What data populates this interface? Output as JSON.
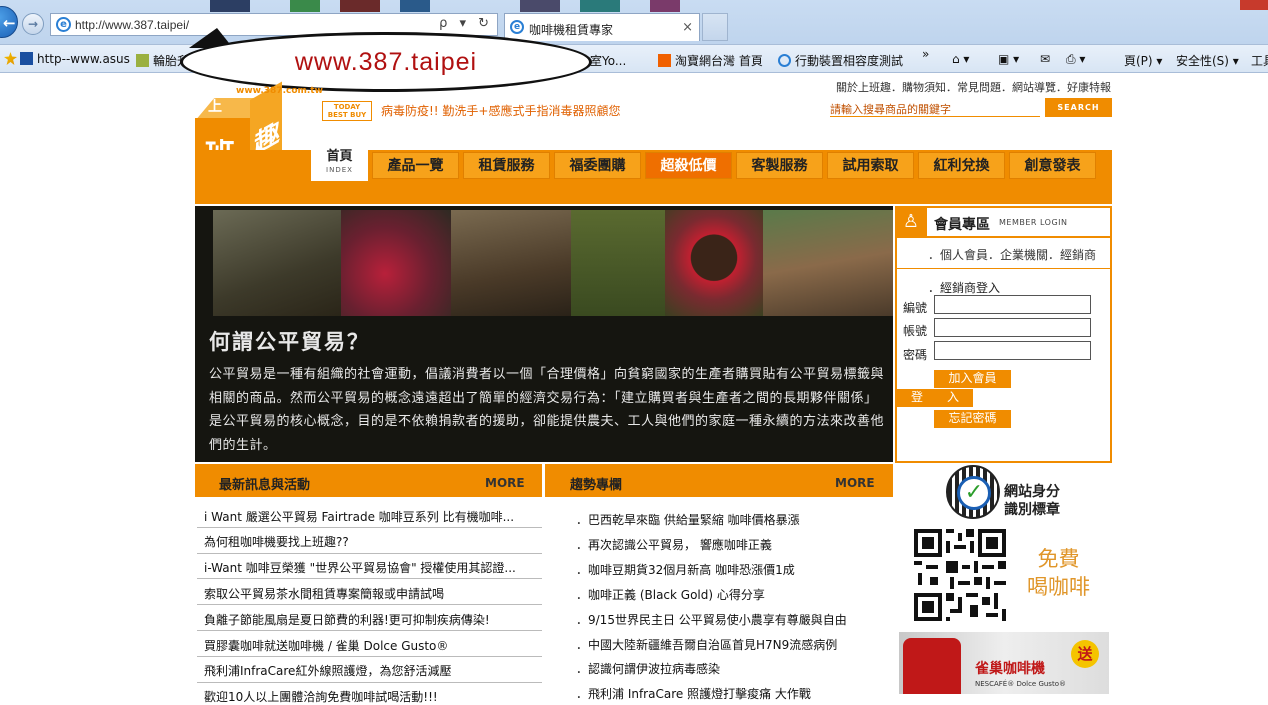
{
  "browser": {
    "url": "http://www.387.taipei/",
    "tab_title": "咖啡機租賃專家",
    "tab_close": "×",
    "address_tools": "ρ ▾ ↻",
    "favorites": [
      "http--www.asus",
      "輪胎升級",
      "課教室Yo...",
      "淘寶網台灣 首頁",
      "行動裝置相容度測試"
    ],
    "fav_more": "»",
    "commands": [
      "頁(P) ▾",
      "安全性(S) ▾",
      "工具"
    ],
    "overlay_text": "www.387.taipei"
  },
  "header": {
    "top_links": "關於上班趣．購物須知．常見問題．網站導覽．好康特報",
    "logo_chars": [
      "班",
      "趣",
      "上"
    ],
    "logo_url": "www.387.com.tw",
    "today_best_buy": "TODAY BEST BUY",
    "promo": "病毒防疫!! 勤洗手+感應式手指消毒器照顧您",
    "search_placeholder": "請輸入搜尋商品的關鍵字",
    "search_button": "SEARCH"
  },
  "nav": {
    "home": "首頁",
    "home_sub": "INDEX",
    "items": [
      "產品一覽",
      "租賃服務",
      "福委團購",
      "超殺低價",
      "客製服務",
      "試用索取",
      "紅利兌換",
      "創意發表"
    ]
  },
  "banner": {
    "title": "何謂公平貿易？",
    "body": "公平貿易是一種有組織的社會運動，倡議消費者以一個「合理價格」向貧窮國家的生產者購買貼有公平貿易標籤與相關的商品。然而公平貿易的概念遠遠超出了簡單的經濟交易行為：「建立購買者與生產者之間的長期夥伴關係」是公平貿易的核心概念，目的是不依賴捐款者的援助，卻能提供農夫、工人與他們的家庭一種永續的方法來改善他們的生計。"
  },
  "member": {
    "title": "會員專區",
    "subtitle": "MEMBER LOGIN",
    "types": "．個人會員．企業機關．經銷商",
    "dealer_login": "．經銷商登入",
    "fields": [
      "編號",
      "帳號",
      "密碼"
    ],
    "join_button": "加入會員",
    "login_button": "登　　入",
    "forgot_button": "忘記密碼"
  },
  "news": {
    "title": "最新訊息與活動",
    "more": "MORE",
    "items": [
      "i Want 嚴選公平貿易 Fairtrade 咖啡豆系列 比有機咖啡...",
      "為何租咖啡機要找上班趣??",
      "i-Want 咖啡豆榮獲 \"世界公平貿易協會\" 授權使用其認證...",
      "索取公平貿易茶水間租賃專案簡報或申請試喝",
      "負離子節能風扇是夏日節費的利器!更可抑制疾病傳染!",
      "買膠囊咖啡就送咖啡機 / 雀巢 Dolce Gusto®",
      "飛利浦InfraCare紅外線照護燈，為您舒活減壓",
      "歡迎10人以上團體洽詢免費咖啡試喝活動!!!"
    ]
  },
  "trends": {
    "title": "趨勢專欄",
    "more": "MORE",
    "items": [
      "．巴西乾旱來臨 供給量緊縮 咖啡價格暴漲",
      "．再次認識公平貿易，  響應咖啡正義",
      "．咖啡豆期貨32個月新高 咖啡恐漲價1成",
      "．咖啡正義 (Black Gold) 心得分享",
      "．9/15世界民主日 公平貿易使小農享有尊嚴與自由",
      "．中國大陸新疆維吾爾自治區首見H7N9流感病例",
      "．認識何謂伊波拉病毒感染",
      "．飛利浦 InfraCare 照護燈打擊痠痛 大作戰"
    ]
  },
  "sidebar": {
    "trust_label_1": "網站身分",
    "trust_label_2": "識別標章",
    "free_coffee_1": "免費",
    "free_coffee_2": "喝咖啡",
    "nescafe_brand": "雀巢咖啡機",
    "nescafe_sub": "NESCAFÉ® Dolce Gusto®",
    "nescafe_badge": "送"
  },
  "colors": {
    "accent": "#f08c00",
    "hot": "#ef6f00",
    "overlay_text": "#b01010"
  }
}
